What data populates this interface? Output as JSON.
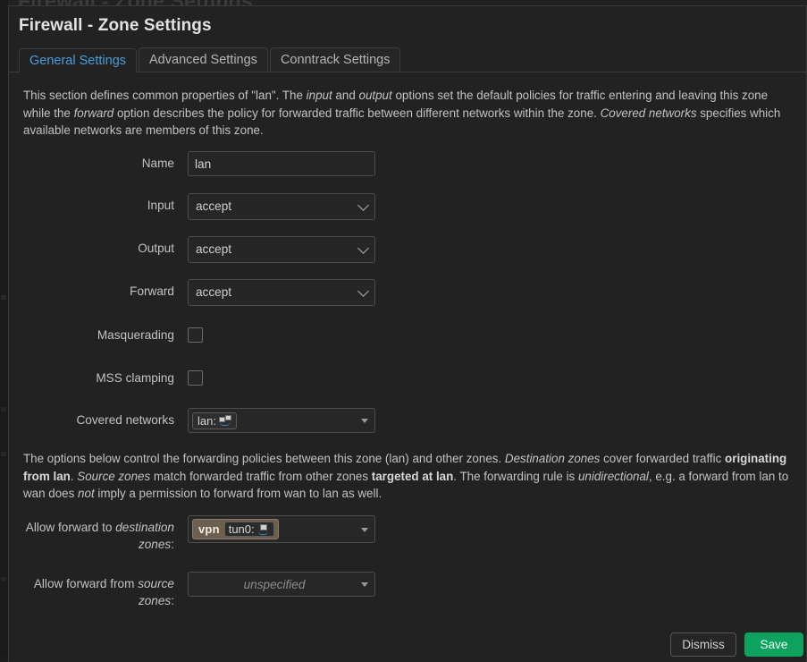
{
  "background": {
    "obscured_title": "Firewall - Zone Settings"
  },
  "modal": {
    "title": "Firewall - Zone Settings",
    "tabs": [
      {
        "label": "General Settings",
        "active": true
      },
      {
        "label": "Advanced Settings",
        "active": false
      },
      {
        "label": "Conntrack Settings",
        "active": false
      }
    ],
    "intro_paragraph": {
      "p1": "This section defines common properties of \"lan\". The ",
      "em1": "input",
      "p2": " and ",
      "em2": "output",
      "p3": " options set the default policies for traffic entering and leaving this zone while the ",
      "em3": "forward",
      "p4": " option describes the policy for forwarded traffic between different networks within the zone. ",
      "em4": "Covered networks",
      "p5": " specifies which available networks are members of this zone."
    },
    "fields": {
      "name": {
        "label": "Name",
        "value": "lan"
      },
      "input": {
        "label": "Input",
        "value": "accept"
      },
      "output": {
        "label": "Output",
        "value": "accept"
      },
      "forward": {
        "label": "Forward",
        "value": "accept"
      },
      "masquerading": {
        "label": "Masquerading",
        "checked": false
      },
      "mss_clamping": {
        "label": "MSS clamping",
        "checked": false
      },
      "covered_networks": {
        "label": "Covered networks",
        "tokens": [
          {
            "text": "lan:",
            "icon": "network-icon"
          }
        ]
      }
    },
    "forwarding_paragraph": {
      "p1": "The options below control the forwarding policies between this zone (lan) and other zones. ",
      "em1": "Destination zones",
      "p2": " cover forwarded traffic ",
      "b1": "originating from lan",
      "p3": ". ",
      "em2": "Source zones",
      "p4": " match forwarded traffic from other zones ",
      "b2": "targeted at lan",
      "p5": ". The forwarding rule is ",
      "em3": "unidirectional",
      "p6": ", e.g. a forward from lan to wan does ",
      "em4": "not",
      "p7": " imply a permission to forward from wan to lan as well."
    },
    "forward_fields": {
      "destination": {
        "label_pre": "Allow forward to ",
        "label_em": "destination zones",
        "label_post": ":",
        "tokens": [
          {
            "zone": "vpn",
            "iface": "tun0:",
            "icon": "network-interface-icon"
          }
        ]
      },
      "source": {
        "label_pre": "Allow forward from ",
        "label_em": "source zones",
        "label_post": ":",
        "placeholder": "unspecified",
        "tokens": []
      }
    },
    "footer": {
      "dismiss_label": "Dismiss",
      "save_label": "Save"
    }
  },
  "colors": {
    "accent_tab": "#4a9ed8",
    "save_button": "#0da25e",
    "zone_token": "#6b604f",
    "modal_bg": "#222222",
    "page_bg": "#212121"
  }
}
